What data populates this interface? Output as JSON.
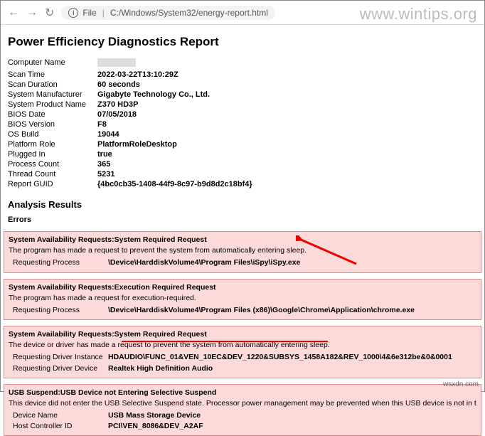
{
  "browser": {
    "file_label": "File",
    "path": "C:/Windows/System32/energy-report.html"
  },
  "watermark": "www.wintips.org",
  "credit": "wsxdn.com",
  "report": {
    "title": "Power Efficiency Diagnostics Report",
    "info": {
      "computer_name_k": "Computer Name",
      "scan_time_k": "Scan Time",
      "scan_time": "2022-03-22T13:10:29Z",
      "scan_duration_k": "Scan Duration",
      "scan_duration": "60 seconds",
      "sys_manu_k": "System Manufacturer",
      "sys_manu": "Gigabyte Technology Co., Ltd.",
      "sys_prod_k": "System Product Name",
      "sys_prod": "Z370 HD3P",
      "bios_date_k": "BIOS Date",
      "bios_date": "07/05/2018",
      "bios_ver_k": "BIOS Version",
      "bios_ver": "F8",
      "os_build_k": "OS Build",
      "os_build": "19044",
      "platform_k": "Platform Role",
      "platform": "PlatformRoleDesktop",
      "plugged_k": "Plugged In",
      "plugged": "true",
      "proc_k": "Process Count",
      "proc": "365",
      "thread_k": "Thread Count",
      "thread": "5231",
      "guid_k": "Report GUID",
      "guid": "{4bc0cb35-1408-44f9-8c97-b9d8d2c18bf4}"
    },
    "analysis_heading": "Analysis Results",
    "errors_heading": "Errors",
    "errors": [
      {
        "title": "System Availability Requests:System Required Request",
        "desc": "The program has made a request to prevent the system from automatically entering sleep.",
        "rows": [
          {
            "k": "Requesting Process",
            "v": "\\Device\\HarddiskVolume4\\Program Files\\iSpy\\iSpy.exe"
          }
        ]
      },
      {
        "title": "System Availability Requests:Execution Required Request",
        "desc": "The program has made a request for execution-required.",
        "rows": [
          {
            "k": "Requesting Process",
            "v": "\\Device\\HarddiskVolume4\\Program Files (x86)\\Google\\Chrome\\Application\\chrome.exe"
          }
        ]
      },
      {
        "title": "System Availability Requests:System Required Request",
        "desc": "The device or driver has made a request to prevent the system from automatically entering sleep.",
        "rows": [
          {
            "k": "Requesting Driver Instance",
            "v": "HDAUDIO\\FUNC_01&VEN_10EC&DEV_1220&SUBSYS_1458A182&REV_1000\\4&6e312be&0&0001"
          },
          {
            "k": "Requesting Driver Device",
            "v": "Realtek High Definition Audio"
          }
        ]
      },
      {
        "title": "USB Suspend:USB Device not Entering Selective Suspend",
        "desc": "This device did not enter the USB Selective Suspend state. Processor power management may be prevented when this USB device is not in the Selective Suspend",
        "rows": [
          {
            "k": "Device Name",
            "v": "USB Mass Storage Device"
          },
          {
            "k": "Host Controller ID",
            "v": "PCI\\VEN_8086&DEV_A2AF"
          }
        ]
      }
    ]
  }
}
